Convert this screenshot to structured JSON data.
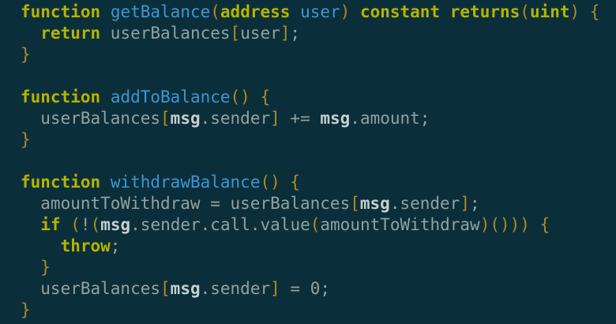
{
  "colors": {
    "background": "#0b2f3a",
    "keyword": "#b6b300",
    "function_name": "#3c96d6",
    "bracket": "#b18a23",
    "identifier": "#93a1a1",
    "builtin": "#c4cfcf"
  },
  "code": {
    "lines": [
      [
        {
          "t": "function",
          "c": "kw"
        },
        {
          "t": " ",
          "c": "id"
        },
        {
          "t": "getBalance",
          "c": "fn"
        },
        {
          "t": "(",
          "c": "br"
        },
        {
          "t": "address",
          "c": "kw"
        },
        {
          "t": " user",
          "c": "fn"
        },
        {
          "t": ")",
          "c": "br"
        },
        {
          "t": " ",
          "c": "id"
        },
        {
          "t": "constant",
          "c": "kw"
        },
        {
          "t": " ",
          "c": "id"
        },
        {
          "t": "returns",
          "c": "kw"
        },
        {
          "t": "(",
          "c": "br"
        },
        {
          "t": "uint",
          "c": "kw"
        },
        {
          "t": ")",
          "c": "br"
        },
        {
          "t": " ",
          "c": "id"
        },
        {
          "t": "{",
          "c": "br"
        }
      ],
      [
        {
          "t": "  ",
          "c": "id"
        },
        {
          "t": "return",
          "c": "kw"
        },
        {
          "t": " userBalances",
          "c": "id"
        },
        {
          "t": "[",
          "c": "br"
        },
        {
          "t": "user",
          "c": "id"
        },
        {
          "t": "]",
          "c": "br"
        },
        {
          "t": ";",
          "c": "id"
        }
      ],
      [
        {
          "t": "}",
          "c": "br"
        }
      ],
      [],
      [
        {
          "t": "function",
          "c": "kw"
        },
        {
          "t": " ",
          "c": "id"
        },
        {
          "t": "addToBalance",
          "c": "fn"
        },
        {
          "t": "()",
          "c": "br"
        },
        {
          "t": " ",
          "c": "id"
        },
        {
          "t": "{",
          "c": "br"
        }
      ],
      [
        {
          "t": "  userBalances",
          "c": "id"
        },
        {
          "t": "[",
          "c": "br"
        },
        {
          "t": "msg",
          "c": "msg"
        },
        {
          "t": ".sender",
          "c": "id"
        },
        {
          "t": "]",
          "c": "br"
        },
        {
          "t": " += ",
          "c": "op"
        },
        {
          "t": "msg",
          "c": "msg"
        },
        {
          "t": ".amount;",
          "c": "id"
        }
      ],
      [
        {
          "t": "}",
          "c": "br"
        }
      ],
      [],
      [
        {
          "t": "function",
          "c": "kw"
        },
        {
          "t": " ",
          "c": "id"
        },
        {
          "t": "withdrawBalance",
          "c": "fn"
        },
        {
          "t": "()",
          "c": "br"
        },
        {
          "t": " ",
          "c": "id"
        },
        {
          "t": "{",
          "c": "br"
        }
      ],
      [
        {
          "t": "  amountToWithdraw = userBalances",
          "c": "id"
        },
        {
          "t": "[",
          "c": "br"
        },
        {
          "t": "msg",
          "c": "msg"
        },
        {
          "t": ".sender",
          "c": "id"
        },
        {
          "t": "]",
          "c": "br"
        },
        {
          "t": ";",
          "c": "id"
        }
      ],
      [
        {
          "t": "  ",
          "c": "id"
        },
        {
          "t": "if",
          "c": "kw"
        },
        {
          "t": " ",
          "c": "id"
        },
        {
          "t": "(",
          "c": "br"
        },
        {
          "t": "!",
          "c": "id"
        },
        {
          "t": "(",
          "c": "br"
        },
        {
          "t": "msg",
          "c": "msg"
        },
        {
          "t": ".sender.call.value",
          "c": "id"
        },
        {
          "t": "(",
          "c": "br"
        },
        {
          "t": "amountToWithdraw",
          "c": "id"
        },
        {
          "t": ")",
          "c": "br"
        },
        {
          "t": "()",
          "c": "br"
        },
        {
          "t": "))",
          "c": "br"
        },
        {
          "t": " ",
          "c": "id"
        },
        {
          "t": "{",
          "c": "br"
        }
      ],
      [
        {
          "t": "    ",
          "c": "id"
        },
        {
          "t": "throw",
          "c": "kw"
        },
        {
          "t": ";",
          "c": "id"
        }
      ],
      [
        {
          "t": "  ",
          "c": "id"
        },
        {
          "t": "}",
          "c": "br"
        }
      ],
      [
        {
          "t": "  userBalances",
          "c": "id"
        },
        {
          "t": "[",
          "c": "br"
        },
        {
          "t": "msg",
          "c": "msg"
        },
        {
          "t": ".sender",
          "c": "id"
        },
        {
          "t": "]",
          "c": "br"
        },
        {
          "t": " = 0;",
          "c": "id"
        }
      ],
      [
        {
          "t": "}",
          "c": "br"
        }
      ]
    ]
  }
}
